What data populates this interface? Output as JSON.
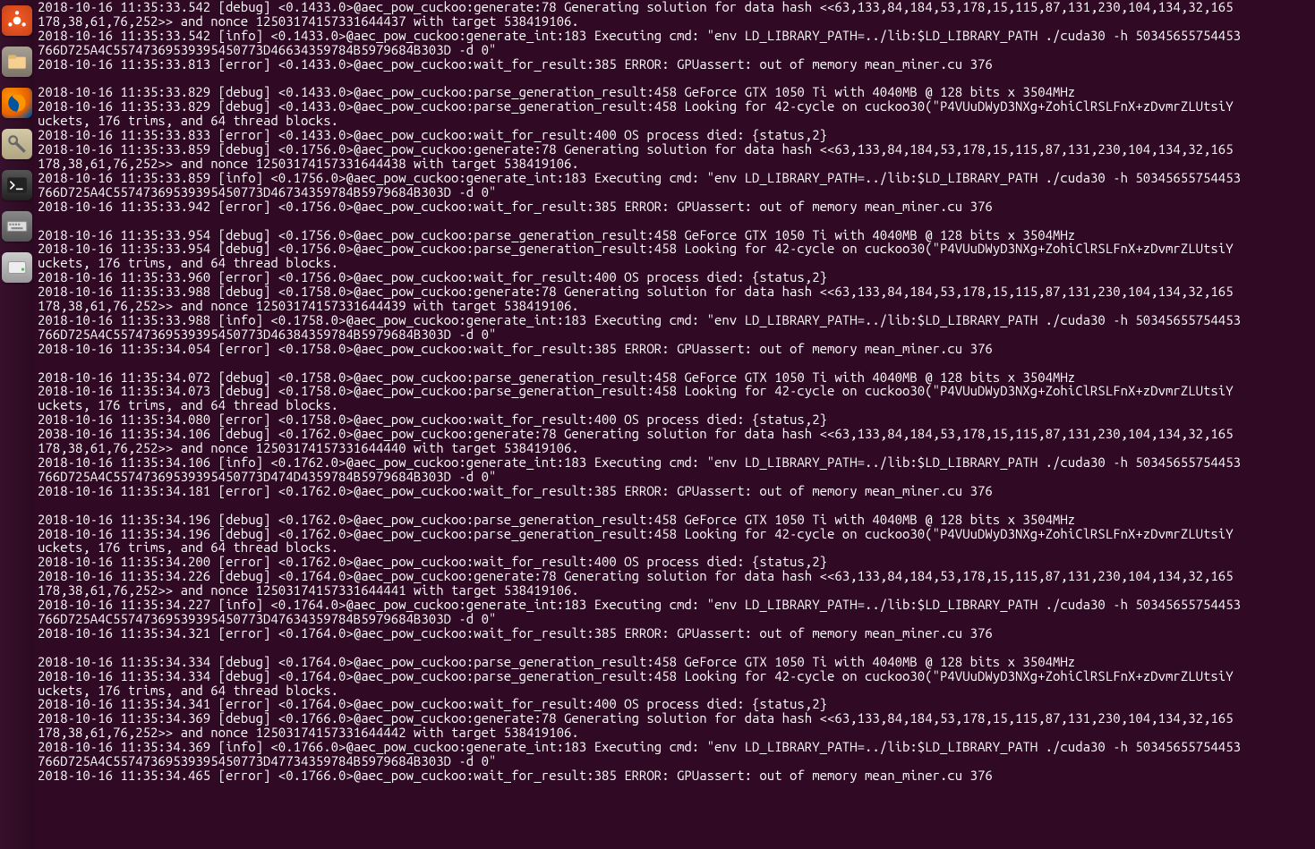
{
  "launcher": {
    "items": [
      {
        "name": "dash-icon",
        "label": "Dash"
      },
      {
        "name": "files-icon",
        "label": "Files"
      },
      {
        "name": "firefox-icon",
        "label": "Firefox"
      },
      {
        "name": "settings-icon",
        "label": "Settings"
      },
      {
        "name": "terminal-icon",
        "label": "Terminal"
      },
      {
        "name": "keyboard-icon",
        "label": "Keyboard"
      },
      {
        "name": "disk-icon",
        "label": "Disk"
      }
    ]
  },
  "terminal": {
    "lines": [
      "2018-10-16 11:35:33.542 [debug] <0.1433.0>@aec_pow_cuckoo:generate:78 Generating solution for data hash <<63,133,84,184,53,178,15,115,87,131,230,104,134,32,165",
      "178,38,61,76,252>> and nonce 12503174157331644437 with target 538419106.",
      "2018-10-16 11:35:33.542 [info] <0.1433.0>@aec_pow_cuckoo:generate_int:183 Executing cmd: \"env LD_LIBRARY_PATH=../lib:$LD_LIBRARY_PATH ./cuda30 -h 50345655754453",
      "766D725A4C55747369539395450773D46634359784B5979684B303D -d 0\"",
      "2018-10-16 11:35:33.813 [error] <0.1433.0>@aec_pow_cuckoo:wait_for_result:385 ERROR: GPUassert: out of memory mean_miner.cu 376",
      "",
      "2018-10-16 11:35:33.829 [debug] <0.1433.0>@aec_pow_cuckoo:parse_generation_result:458 GeForce GTX 1050 Ti with 4040MB @ 128 bits x 3504MHz",
      "2018-10-16 11:35:33.829 [debug] <0.1433.0>@aec_pow_cuckoo:parse_generation_result:458 Looking for 42-cycle on cuckoo30(\"P4VUuDWyD3NXg+ZohiClRSLFnX+zDvmrZLUtsiY",
      "uckets, 176 trims, and 64 thread blocks.",
      "2018-10-16 11:35:33.833 [error] <0.1433.0>@aec_pow_cuckoo:wait_for_result:400 OS process died: {status,2}",
      "2018-10-16 11:35:33.859 [debug] <0.1756.0>@aec_pow_cuckoo:generate:78 Generating solution for data hash <<63,133,84,184,53,178,15,115,87,131,230,104,134,32,165",
      "178,38,61,76,252>> and nonce 12503174157331644438 with target 538419106.",
      "2018-10-16 11:35:33.859 [info] <0.1756.0>@aec_pow_cuckoo:generate_int:183 Executing cmd: \"env LD_LIBRARY_PATH=../lib:$LD_LIBRARY_PATH ./cuda30 -h 50345655754453",
      "766D725A4C55747369539395450773D46734359784B5979684B303D -d 0\"",
      "2018-10-16 11:35:33.942 [error] <0.1756.0>@aec_pow_cuckoo:wait_for_result:385 ERROR: GPUassert: out of memory mean_miner.cu 376",
      "",
      "2018-10-16 11:35:33.954 [debug] <0.1756.0>@aec_pow_cuckoo:parse_generation_result:458 GeForce GTX 1050 Ti with 4040MB @ 128 bits x 3504MHz",
      "2018-10-16 11:35:33.954 [debug] <0.1756.0>@aec_pow_cuckoo:parse_generation_result:458 Looking for 42-cycle on cuckoo30(\"P4VUuDWyD3NXg+ZohiClRSLFnX+zDvmrZLUtsiY",
      "uckets, 176 trims, and 64 thread blocks.",
      "2018-10-16 11:35:33.960 [error] <0.1756.0>@aec_pow_cuckoo:wait_for_result:400 OS process died: {status,2}",
      "2018-10-16 11:35:33.988 [debug] <0.1758.0>@aec_pow_cuckoo:generate:78 Generating solution for data hash <<63,133,84,184,53,178,15,115,87,131,230,104,134,32,165",
      "178,38,61,76,252>> and nonce 12503174157331644439 with target 538419106.",
      "2018-10-16 11:35:33.988 [info] <0.1758.0>@aec_pow_cuckoo:generate_int:183 Executing cmd: \"env LD_LIBRARY_PATH=../lib:$LD_LIBRARY_PATH ./cuda30 -h 50345655754453",
      "766D725A4C55747369539395450773D46384359784B5979684B303D -d 0\"",
      "2018-10-16 11:35:34.054 [error] <0.1758.0>@aec_pow_cuckoo:wait_for_result:385 ERROR: GPUassert: out of memory mean_miner.cu 376",
      "",
      "2018-10-16 11:35:34.072 [debug] <0.1758.0>@aec_pow_cuckoo:parse_generation_result:458 GeForce GTX 1050 Ti with 4040MB @ 128 bits x 3504MHz",
      "2018-10-16 11:35:34.073 [debug] <0.1758.0>@aec_pow_cuckoo:parse_generation_result:458 Looking for 42-cycle on cuckoo30(\"P4VUuDWyD3NXg+ZohiClRSLFnX+zDvmrZLUtsiY",
      "uckets, 176 trims, and 64 thread blocks.",
      "2018-10-16 11:35:34.080 [error] <0.1758.0>@aec_pow_cuckoo:wait_for_result:400 OS process died: {status,2}",
      "2038-10-16 11:35:34.106 [debug] <0.1762.0>@aec_pow_cuckoo:generate:78 Generating solution for data hash <<63,133,84,184,53,178,15,115,87,131,230,104,134,32,165",
      "178,38,61,76,252>> and nonce 12503174157331644440 with target 538419106.",
      "2018-10-16 11:35:34.106 [info] <0.1762.0>@aec_pow_cuckoo:generate_int:183 Executing cmd: \"env LD_LIBRARY_PATH=../lib:$LD_LIBRARY_PATH ./cuda30 -h 50345655754453",
      "766D725A4C55747369539395450773D474D4359784B5979684B303D -d 0\"",
      "2018-10-16 11:35:34.181 [error] <0.1762.0>@aec_pow_cuckoo:wait_for_result:385 ERROR: GPUassert: out of memory mean_miner.cu 376",
      "",
      "2018-10-16 11:35:34.196 [debug] <0.1762.0>@aec_pow_cuckoo:parse_generation_result:458 GeForce GTX 1050 Ti with 4040MB @ 128 bits x 3504MHz",
      "2018-10-16 11:35:34.196 [debug] <0.1762.0>@aec_pow_cuckoo:parse_generation_result:458 Looking for 42-cycle on cuckoo30(\"P4VUuDWyD3NXg+ZohiClRSLFnX+zDvmrZLUtsiY",
      "uckets, 176 trims, and 64 thread blocks.",
      "2018-10-16 11:35:34.200 [error] <0.1762.0>@aec_pow_cuckoo:wait_for_result:400 OS process died: {status,2}",
      "2018-10-16 11:35:34.226 [debug] <0.1764.0>@aec_pow_cuckoo:generate:78 Generating solution for data hash <<63,133,84,184,53,178,15,115,87,131,230,104,134,32,165",
      "178,38,61,76,252>> and nonce 12503174157331644441 with target 538419106.",
      "2018-10-16 11:35:34.227 [info] <0.1764.0>@aec_pow_cuckoo:generate_int:183 Executing cmd: \"env LD_LIBRARY_PATH=../lib:$LD_LIBRARY_PATH ./cuda30 -h 50345655754453",
      "766D725A4C55747369539395450773D47634359784B5979684B303D -d 0\"",
      "2018-10-16 11:35:34.321 [error] <0.1764.0>@aec_pow_cuckoo:wait_for_result:385 ERROR: GPUassert: out of memory mean_miner.cu 376",
      "",
      "2018-10-16 11:35:34.334 [debug] <0.1764.0>@aec_pow_cuckoo:parse_generation_result:458 GeForce GTX 1050 Ti with 4040MB @ 128 bits x 3504MHz",
      "2018-10-16 11:35:34.334 [debug] <0.1764.0>@aec_pow_cuckoo:parse_generation_result:458 Looking for 42-cycle on cuckoo30(\"P4VUuDWyD3NXg+ZohiClRSLFnX+zDvmrZLUtsiY",
      "uckets, 176 trims, and 64 thread blocks.",
      "2018-10-16 11:35:34.341 [error] <0.1764.0>@aec_pow_cuckoo:wait_for_result:400 OS process died: {status,2}",
      "2018-10-16 11:35:34.369 [debug] <0.1766.0>@aec_pow_cuckoo:generate:78 Generating solution for data hash <<63,133,84,184,53,178,15,115,87,131,230,104,134,32,165",
      "178,38,61,76,252>> and nonce 12503174157331644442 with target 538419106.",
      "2018-10-16 11:35:34.369 [info] <0.1766.0>@aec_pow_cuckoo:generate_int:183 Executing cmd: \"env LD_LIBRARY_PATH=../lib:$LD_LIBRARY_PATH ./cuda30 -h 50345655754453",
      "766D725A4C55747369539395450773D47734359784B5979684B303D -d 0\"",
      "2018-10-16 11:35:34.465 [error] <0.1766.0>@aec_pow_cuckoo:wait_for_result:385 ERROR: GPUassert: out of memory mean_miner.cu 376",
      ""
    ]
  }
}
